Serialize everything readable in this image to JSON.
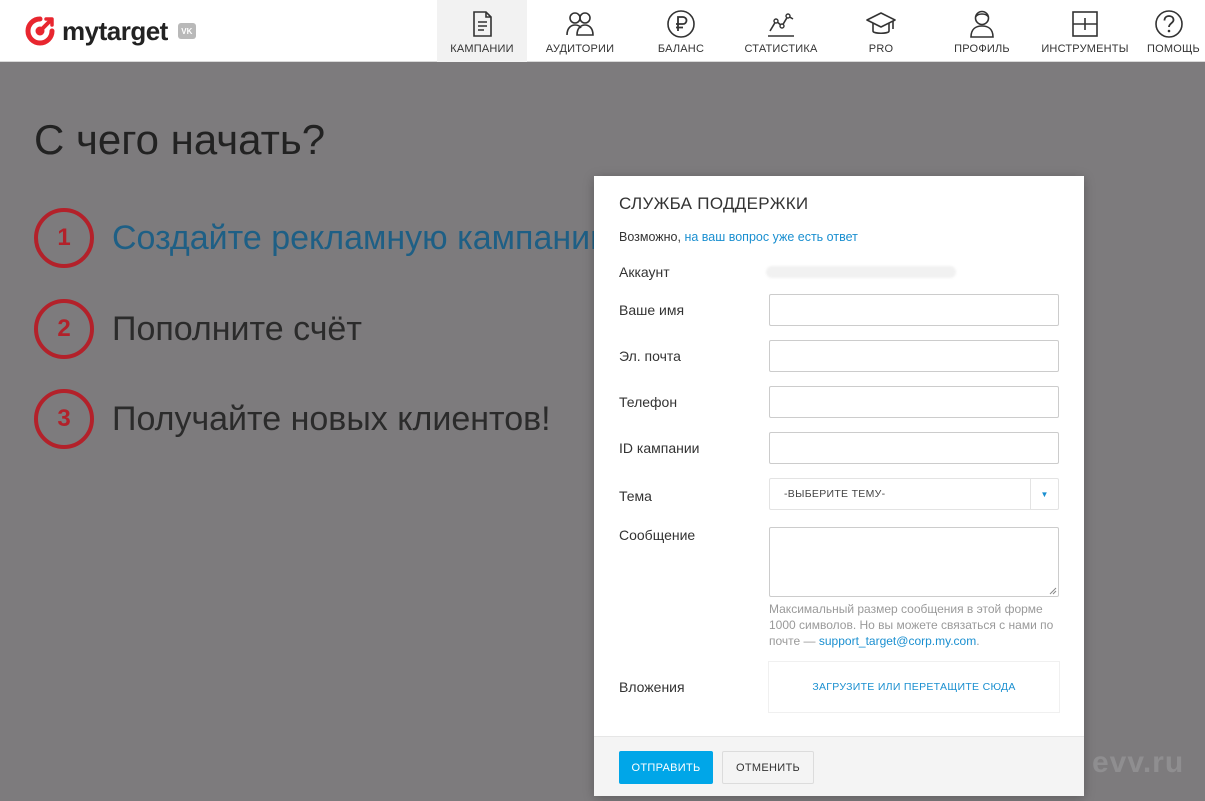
{
  "header": {
    "logo_text": "mytarget",
    "vk_badge": "VK",
    "nav": [
      {
        "label": "КАМПАНИИ",
        "icon": "campaigns-icon",
        "active": true
      },
      {
        "label": "АУДИТОРИИ",
        "icon": "audiences-icon",
        "active": false
      },
      {
        "label": "БАЛАНС",
        "icon": "ruble-icon",
        "active": false
      },
      {
        "label": "СТАТИСТИКА",
        "icon": "statistics-icon",
        "active": false
      },
      {
        "label": "PRO",
        "icon": "graduation-cap-icon",
        "active": false
      },
      {
        "label": "ПРОФИЛЬ",
        "icon": "profile-icon",
        "active": false
      },
      {
        "label": "ИНСТРУМЕНТЫ",
        "icon": "tools-icon",
        "active": false
      },
      {
        "label": "ПОМОЩЬ",
        "icon": "help-icon",
        "active": false
      }
    ]
  },
  "main": {
    "title": "С чего начать?",
    "steps": [
      {
        "num": "1",
        "text": "Создайте рекламную кампанию"
      },
      {
        "num": "2",
        "text": "Пополните счёт"
      },
      {
        "num": "3",
        "text": "Получайте новых клиентов!"
      }
    ]
  },
  "watermark": "evv.ru",
  "modal": {
    "title": "СЛУЖБА ПОДДЕРЖКИ",
    "hint_prefix": "Возможно, ",
    "hint_link": "на ваш вопрос уже есть ответ",
    "fields": {
      "account_label": "Аккаунт",
      "name_label": "Ваше имя",
      "email_label": "Эл. почта",
      "phone_label": "Телефон",
      "campaign_id_label": "ID кампании",
      "topic_label": "Тема",
      "topic_value": "-ВЫБЕРИТЕ ТЕМУ-",
      "message_label": "Сообщение",
      "attachments_label": "Вложения"
    },
    "note_text": "Максимальный размер сообщения в этой форме 1000 символов. Но вы можете связаться с нами по почте — ",
    "note_email": "support_target@corp.my.com",
    "note_end": ".",
    "dropzone_label": "ЗАГРУЗИТЕ ИЛИ ПЕРЕТАЩИТЕ СЮДА",
    "submit_label": "ОТПРАВИТЬ",
    "cancel_label": "ОТМЕНИТЬ"
  },
  "colors": {
    "accent": "#00a6e8",
    "link": "#1a8fd0",
    "brand_red": "#e8262f",
    "step_red": "#b3212a",
    "overlay": "#7d7b7d"
  }
}
